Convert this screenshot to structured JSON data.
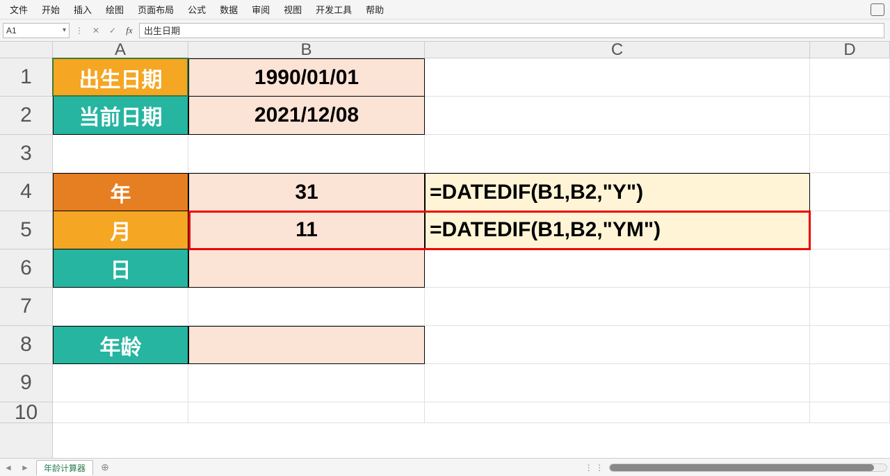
{
  "menu": {
    "items": [
      "文件",
      "开始",
      "插入",
      "绘图",
      "页面布局",
      "公式",
      "数据",
      "审阅",
      "视图",
      "开发工具",
      "帮助"
    ]
  },
  "toolbar": {
    "nameBoxValue": "A1",
    "fx": "fx",
    "formulaBarValue": "出生日期"
  },
  "columns": [
    "A",
    "B",
    "C",
    "D"
  ],
  "rows": [
    "1",
    "2",
    "3",
    "4",
    "5",
    "6",
    "7",
    "8",
    "9",
    "10"
  ],
  "cells": {
    "A1": "出生日期",
    "B1": "1990/01/01",
    "A2": "当前日期",
    "B2": "2021/12/08",
    "A4": "年",
    "B4": "31",
    "C4": "=DATEDIF(B1,B2,\"Y\")",
    "A5": "月",
    "B5": "11",
    "C5": "=DATEDIF(B1,B2,\"YM\")",
    "A6": "日",
    "A8": "年龄"
  },
  "tabs": {
    "active": "年龄计算器"
  }
}
